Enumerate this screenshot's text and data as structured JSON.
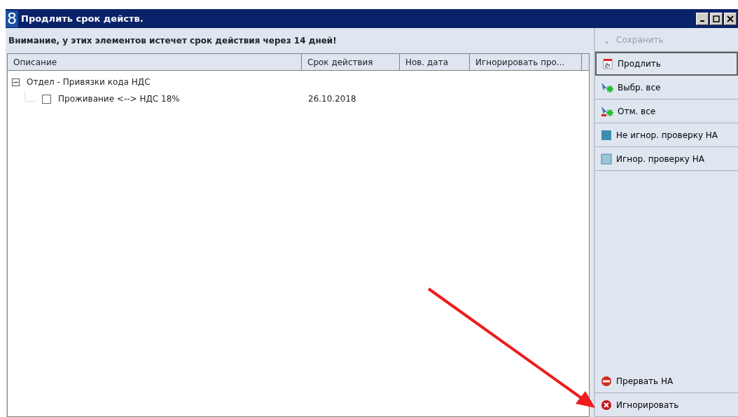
{
  "window": {
    "logo": "8",
    "title": "Продлить срок действ."
  },
  "warning": "Внимание, у этих элементов истечет срок действия через 14 дней!",
  "table": {
    "columns": [
      "Описание",
      "Срок действия",
      "Нов. дата",
      "Игнорировать про..."
    ],
    "rows": [
      {
        "label": "Отдел - Привязки кода НДС",
        "expanded": true,
        "children": [
          {
            "label": "Проживание <--> НДС 18%",
            "checked": false,
            "date": "26.10.2018"
          }
        ]
      }
    ]
  },
  "actions": [
    {
      "label": "Сохранить",
      "kind": "dot",
      "disabled": true,
      "focused": false
    },
    {
      "label": "Продлить",
      "kind": "calendar",
      "disabled": false,
      "focused": true
    },
    {
      "label": "Выбр. все",
      "kind": "select-all",
      "disabled": false,
      "focused": false
    },
    {
      "label": "Отм. все",
      "kind": "deselect-all",
      "disabled": false,
      "focused": false
    },
    {
      "label": "Не игнор. проверку НА",
      "kind": "square-dark",
      "disabled": false,
      "focused": false
    },
    {
      "label": "Игнор. проверку НА",
      "kind": "square-light",
      "disabled": false,
      "focused": false
    }
  ],
  "bottom_actions": [
    {
      "label": "Прервать НА",
      "kind": "stop",
      "disabled": false,
      "focused": false
    },
    {
      "label": "Игнорировать",
      "kind": "cancel",
      "disabled": false,
      "focused": false
    }
  ]
}
